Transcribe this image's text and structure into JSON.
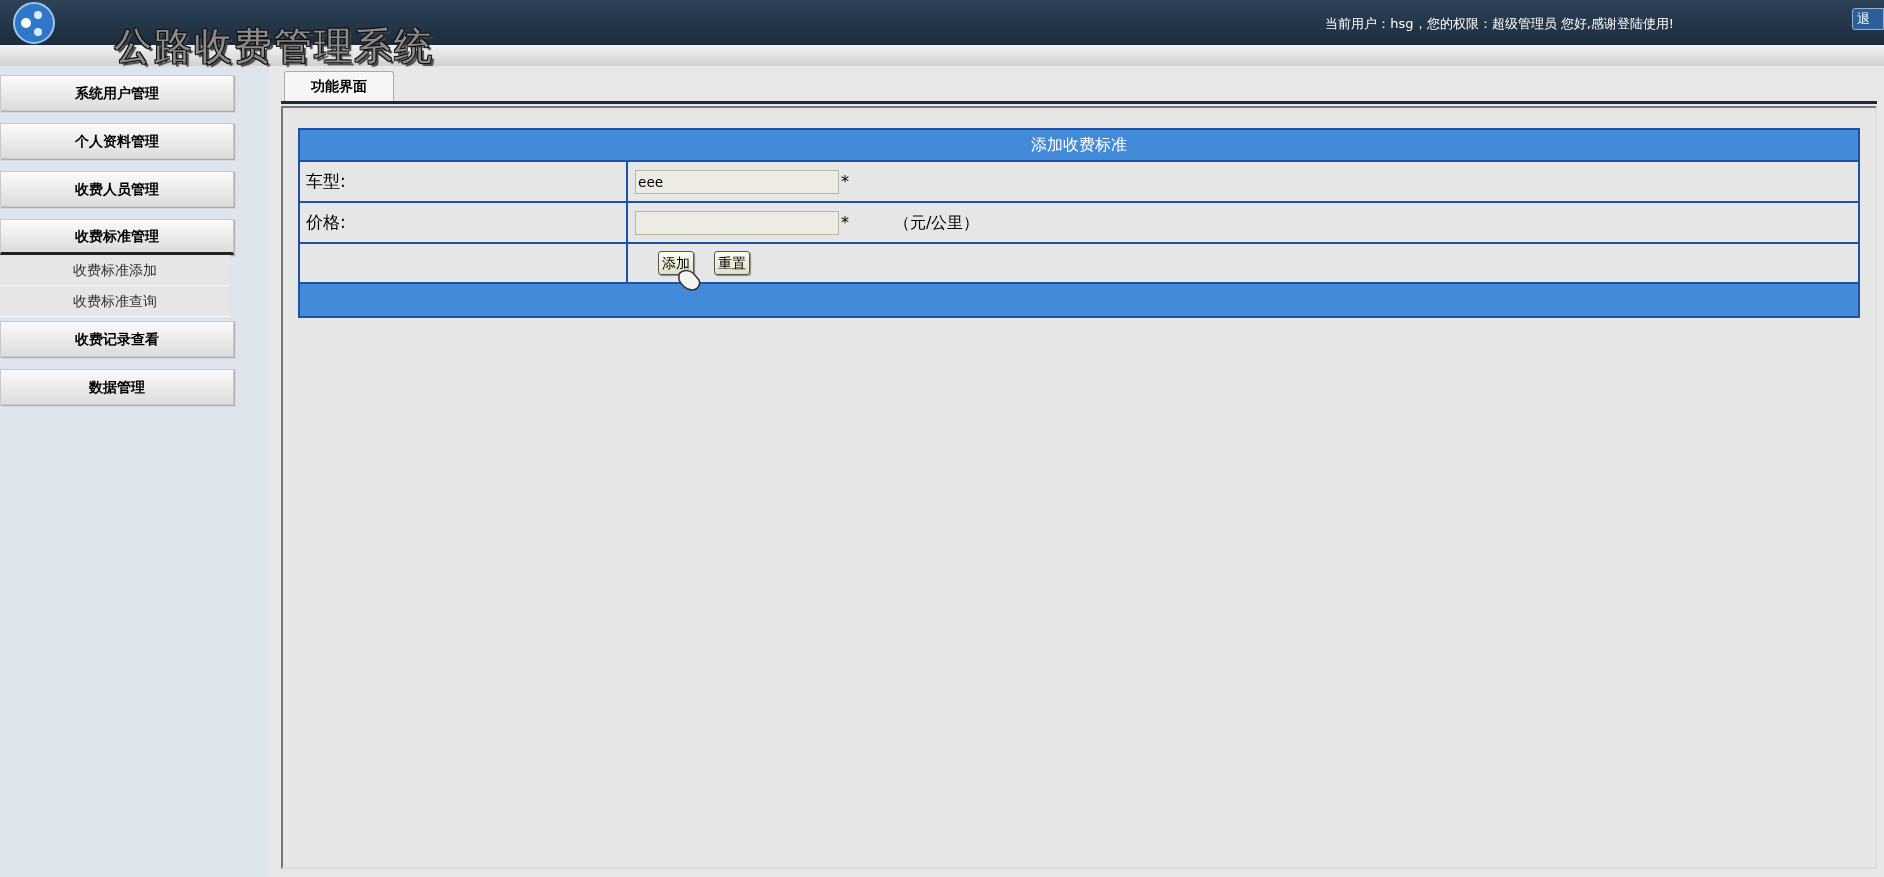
{
  "header": {
    "title": "公路收费管理系统",
    "user_info": "当前用户：hsg，您的权限：超级管理员 您好,感谢登陆使用!",
    "logout_button": "退"
  },
  "sidebar": {
    "items": [
      {
        "label": "系统用户管理",
        "expanded": false
      },
      {
        "label": "个人资料管理",
        "expanded": false
      },
      {
        "label": "收费人员管理",
        "expanded": false
      },
      {
        "label": "收费标准管理",
        "expanded": true,
        "children": [
          {
            "label": "收费标准添加"
          },
          {
            "label": "收费标准查询"
          }
        ]
      },
      {
        "label": "收费记录查看",
        "expanded": false
      },
      {
        "label": "数据管理",
        "expanded": false
      }
    ]
  },
  "tabs": [
    {
      "label": "功能界面",
      "selected": true
    }
  ],
  "form": {
    "title": "添加收费标准",
    "fields": [
      {
        "label": "车型:",
        "value": "eee",
        "required_mark": "*"
      },
      {
        "label": "价格:",
        "required_mark": "*",
        "unit": "（元/公里）"
      }
    ],
    "buttons": [
      "添加",
      "重置"
    ]
  }
}
